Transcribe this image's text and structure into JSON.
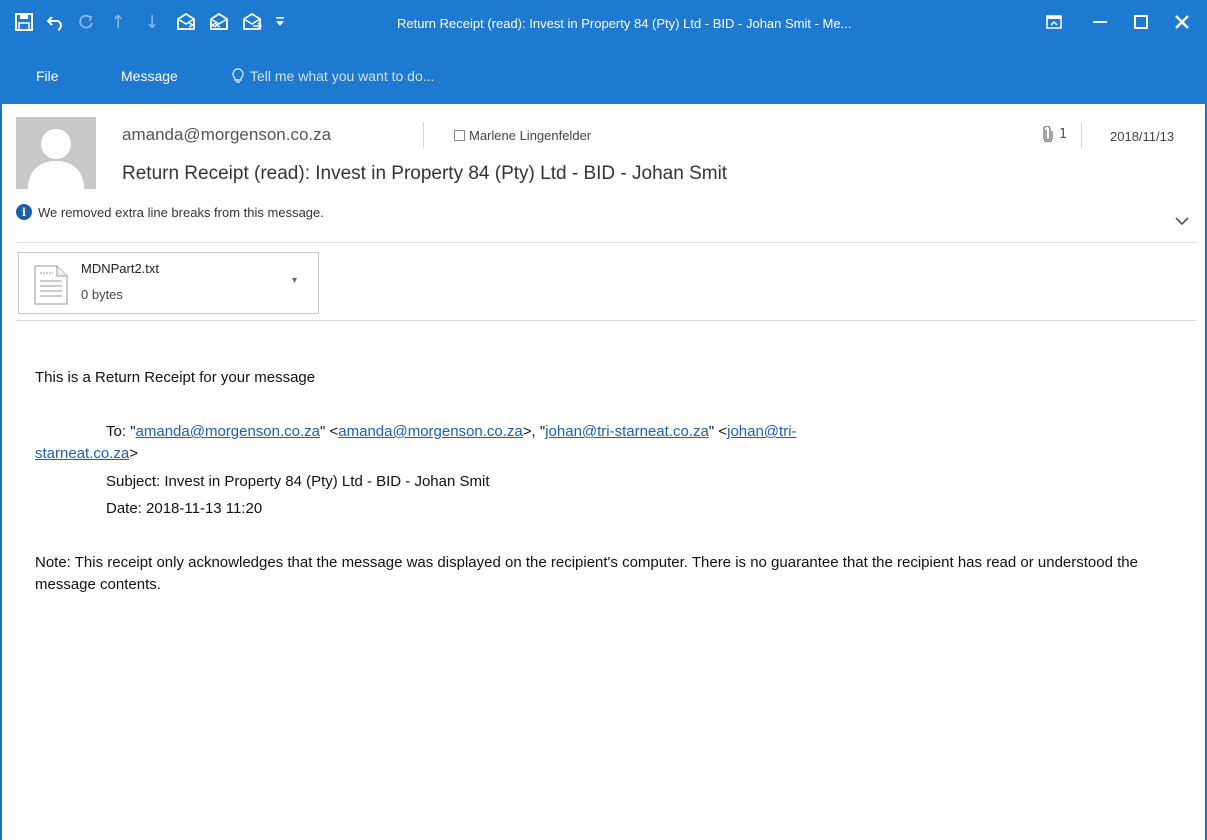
{
  "window": {
    "title": "Return Receipt (read): Invest in Property 84 (Pty) Ltd - BID - Johan Smit - Me...",
    "colors": {
      "title_bar": "#1e79d1",
      "link": "#1c5dbf"
    }
  },
  "quick_access": [
    "save-icon",
    "undo-icon",
    "redo-icon",
    "up-icon",
    "down-icon",
    "reply-icon",
    "reply-all-icon",
    "forward-icon",
    "customize-icon"
  ],
  "ribbon": {
    "tabs": [
      "File",
      "Message"
    ],
    "tell_me_placeholder": "Tell me what you want to do..."
  },
  "message": {
    "sender": "amanda@morgenson.co.za",
    "recipient": "Marlene Lingenfelder",
    "attachment_count": "1",
    "date": "2018/11/13",
    "subject": "Return Receipt (read): Invest in Property 84 (Pty) Ltd - BID - Johan Smit",
    "info_notice": "We removed extra line breaks from this message."
  },
  "attachment": {
    "name": "MDNPart2.txt",
    "size": "0 bytes"
  },
  "body": {
    "intro": "This is a Return Receipt for your message",
    "to_label": "To: ",
    "to_q1": "\"",
    "to_email1": "amanda@morgenson.co.za",
    "to_q2": "\" <",
    "to_email1b": "amanda@morgenson.co.za",
    "to_sep": ">, \"",
    "to_email2": "johan@tri-starneat.co.za",
    "to_q3": "\" <",
    "to_email2b_part1": "johan@tri-",
    "to_email2b_part2": "starneat.co.za",
    "to_close": ">",
    "subject_line": "Subject: Invest in Property 84 (Pty) Ltd - BID - Johan Smit",
    "date_line": "Date: 2018-11-13 11:20",
    "note": "Note: This receipt only acknowledges that the message was displayed on the recipient's computer. There is no guarantee that the recipient has read or understood the message contents."
  }
}
